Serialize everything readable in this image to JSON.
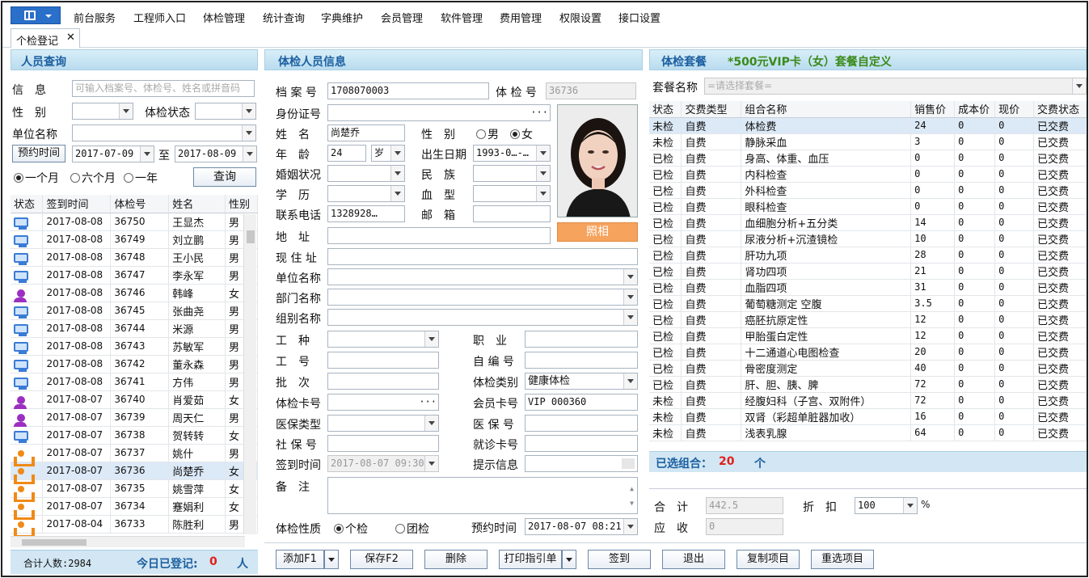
{
  "menu": {
    "items": [
      "前台服务",
      "工程师入口",
      "体检管理",
      "统计查询",
      "字典维护",
      "会员管理",
      "软件管理",
      "费用管理",
      "权限设置",
      "接口设置"
    ]
  },
  "tabs": {
    "active": "个检登记",
    "close": "✕"
  },
  "left": {
    "title": "人员查询",
    "info_label": "信　息",
    "info_placeholder": "可输入档案号、体检号、姓名或拼音码",
    "gender_label": "性　别",
    "status_label": "体检状态",
    "unit_label": "单位名称",
    "appt_label": "预约时间",
    "date_from": "2017-07-09",
    "to": "至",
    "date_to": "2017-08-09",
    "ranges": [
      "一个月",
      "六个月",
      "一年"
    ],
    "query_btn": "查询",
    "columns": [
      "状态",
      "签到时间",
      "体检号",
      "姓名",
      "性别"
    ],
    "rows": [
      {
        "icon": "pc",
        "date": "2017-08-08",
        "id": "36750",
        "name": "王显杰",
        "sex": "男"
      },
      {
        "icon": "pc",
        "date": "2017-08-08",
        "id": "36749",
        "name": "刘立鹏",
        "sex": "男"
      },
      {
        "icon": "pc",
        "date": "2017-08-08",
        "id": "36748",
        "name": "王小民",
        "sex": "男"
      },
      {
        "icon": "pc",
        "date": "2017-08-08",
        "id": "36747",
        "name": "李永军",
        "sex": "男"
      },
      {
        "icon": "f",
        "date": "2017-08-08",
        "id": "36746",
        "name": "韩峰",
        "sex": "女"
      },
      {
        "icon": "pc",
        "date": "2017-08-08",
        "id": "36745",
        "name": "张曲尧",
        "sex": "男"
      },
      {
        "icon": "pc",
        "date": "2017-08-08",
        "id": "36744",
        "name": "米源",
        "sex": "男"
      },
      {
        "icon": "pc",
        "date": "2017-08-08",
        "id": "36743",
        "name": "苏敏军",
        "sex": "男"
      },
      {
        "icon": "pc",
        "date": "2017-08-08",
        "id": "36742",
        "name": "董永森",
        "sex": "男"
      },
      {
        "icon": "pc",
        "date": "2017-08-08",
        "id": "36741",
        "name": "方伟",
        "sex": "男"
      },
      {
        "icon": "f",
        "date": "2017-08-07",
        "id": "36740",
        "name": "肖爱茹",
        "sex": "女"
      },
      {
        "icon": "f",
        "date": "2017-08-07",
        "id": "36739",
        "name": "周天仁",
        "sex": "男"
      },
      {
        "icon": "pc",
        "date": "2017-08-07",
        "id": "36738",
        "name": "贺转转",
        "sex": "女"
      },
      {
        "icon": "o",
        "date": "2017-08-07",
        "id": "36737",
        "name": "姚什",
        "sex": "男"
      },
      {
        "icon": "o",
        "date": "2017-08-07",
        "id": "36736",
        "name": "尚楚乔",
        "sex": "女",
        "selected": true
      },
      {
        "icon": "o",
        "date": "2017-08-07",
        "id": "36735",
        "name": "姚雪萍",
        "sex": "女"
      },
      {
        "icon": "o",
        "date": "2017-08-07",
        "id": "36734",
        "name": "蹇娟利",
        "sex": "女"
      },
      {
        "icon": "o",
        "date": "2017-08-04",
        "id": "36733",
        "name": "陈胜利",
        "sex": "男"
      }
    ],
    "total_label": "合计人数:2984",
    "today_label": "今日已登记:",
    "today_count": "0",
    "today_unit": "人"
  },
  "mid": {
    "title": "体检人员信息",
    "archive_label": "档 案 号",
    "archive": "1708070003",
    "exam_no_label": "体 检 号",
    "exam_no": "36736",
    "idcard_label": "身份证号",
    "name_label": "姓　名",
    "name": "尚楚乔",
    "sex_label": "性　别",
    "male": "男",
    "female": "女",
    "age_label": "年　龄",
    "age": "24",
    "age_unit": "岁",
    "birth_label": "出生日期",
    "birth": "1993-0…-…",
    "marital_label": "婚姻状况",
    "nation_label": "民　族",
    "edu_label": "学　历",
    "blood_label": "血　型",
    "phone_label": "联系电话",
    "phone": "1328928…",
    "email_label": "邮　箱",
    "addr_label": "地　址",
    "cur_addr_label": "现 住 址",
    "unit_label": "单位名称",
    "dept_label": "部门名称",
    "group_label": "组别名称",
    "work_label": "工　种",
    "job_label": "职　业",
    "empno_label": "工　号",
    "selfno_label": "自 编 号",
    "batch_label": "批　次",
    "category_label": "体检类别",
    "category": "健康体检",
    "card_label": "体检卡号",
    "member_label": "会员卡号",
    "member": "VIP 000360",
    "ins_type_label": "医保类型",
    "ins_no_label": "医 保 号",
    "social_label": "社 保 号",
    "visit_label": "就诊卡号",
    "checkin_label": "签到时间",
    "checkin": "2017-08-07 09:30",
    "hint_label": "提示信息",
    "remark_label": "备　注",
    "nature_label": "体检性质",
    "personal": "个检",
    "group": "团检",
    "appt_label": "预约时间",
    "appt": "2017-08-07 08:21",
    "photo_btn": "照相"
  },
  "right": {
    "title": "体检套餐",
    "package": "*500元VIP卡（女）套餐自定义",
    "pkg_label": "套餐名称",
    "pkg_placeholder": "=请选择套餐=",
    "columns": [
      "状态",
      "交费类型",
      "组合名称",
      "销售价",
      "成本价",
      "现价",
      "交费状态"
    ],
    "rows": [
      {
        "s": "未检",
        "t": "自费",
        "n": "体检费",
        "p": "24",
        "c": "0",
        "x": "0",
        "ps": "已交费",
        "selected": true
      },
      {
        "s": "未检",
        "t": "自费",
        "n": "静脉采血",
        "p": "3",
        "c": "0",
        "x": "0",
        "ps": "已交费"
      },
      {
        "s": "已检",
        "t": "自费",
        "n": "身高、体重、血压",
        "p": "0",
        "c": "0",
        "x": "0",
        "ps": "已交费"
      },
      {
        "s": "已检",
        "t": "自费",
        "n": "内科检查",
        "p": "0",
        "c": "0",
        "x": "0",
        "ps": "已交费"
      },
      {
        "s": "已检",
        "t": "自费",
        "n": "外科检查",
        "p": "0",
        "c": "0",
        "x": "0",
        "ps": "已交费"
      },
      {
        "s": "已检",
        "t": "自费",
        "n": "眼科检查",
        "p": "0",
        "c": "0",
        "x": "0",
        "ps": "已交费"
      },
      {
        "s": "已检",
        "t": "自费",
        "n": "血细胞分析+五分类",
        "p": "14",
        "c": "0",
        "x": "0",
        "ps": "已交费"
      },
      {
        "s": "已检",
        "t": "自费",
        "n": "尿液分析+沉渣镜检",
        "p": "10",
        "c": "0",
        "x": "0",
        "ps": "已交费"
      },
      {
        "s": "已检",
        "t": "自费",
        "n": "肝功九项",
        "p": "28",
        "c": "0",
        "x": "0",
        "ps": "已交费"
      },
      {
        "s": "已检",
        "t": "自费",
        "n": "肾功四项",
        "p": "21",
        "c": "0",
        "x": "0",
        "ps": "已交费"
      },
      {
        "s": "已检",
        "t": "自费",
        "n": "血脂四项",
        "p": "31",
        "c": "0",
        "x": "0",
        "ps": "已交费"
      },
      {
        "s": "已检",
        "t": "自费",
        "n": "葡萄糖测定 空腹",
        "p": "3.5",
        "c": "0",
        "x": "0",
        "ps": "已交费"
      },
      {
        "s": "已检",
        "t": "自费",
        "n": "癌胚抗原定性",
        "p": "12",
        "c": "0",
        "x": "0",
        "ps": "已交费"
      },
      {
        "s": "已检",
        "t": "自费",
        "n": "甲胎蛋白定性",
        "p": "12",
        "c": "0",
        "x": "0",
        "ps": "已交费"
      },
      {
        "s": "已检",
        "t": "自费",
        "n": "十二通道心电图检查",
        "p": "20",
        "c": "0",
        "x": "0",
        "ps": "已交费"
      },
      {
        "s": "已检",
        "t": "自费",
        "n": "骨密度测定",
        "p": "40",
        "c": "0",
        "x": "0",
        "ps": "已交费"
      },
      {
        "s": "已检",
        "t": "自费",
        "n": "肝、胆、胰、脾",
        "p": "72",
        "c": "0",
        "x": "0",
        "ps": "已交费"
      },
      {
        "s": "未检",
        "t": "自费",
        "n": "经腹妇科（子宫、双附件）",
        "p": "72",
        "c": "0",
        "x": "0",
        "ps": "已交费"
      },
      {
        "s": "未检",
        "t": "自费",
        "n": "双肾（彩超单脏器加收）",
        "p": "16",
        "c": "0",
        "x": "0",
        "ps": "已交费"
      },
      {
        "s": "未检",
        "t": "自费",
        "n": "浅表乳腺",
        "p": "64",
        "c": "0",
        "x": "0",
        "ps": "已交费"
      }
    ],
    "selected_label": "已选组合：",
    "selected_count": "20",
    "selected_unit": "个",
    "total_label": "合　计",
    "total": "442.5",
    "discount_label": "折　扣",
    "discount": "100",
    "percent": "%",
    "due_label": "应　收",
    "due": "0"
  },
  "toolbar": {
    "add": "添加F1",
    "save": "保存F2",
    "delete": "删除",
    "print": "打印指引单",
    "checkin": "签到",
    "exit": "退出",
    "copy": "复制项目",
    "reselect": "重选项目"
  },
  "colors": {
    "header_text": "#1b5fa0",
    "package_text": "#3a8a1a",
    "count_red": "#e0201a",
    "panel_bg": "#d8eef8",
    "selected_row": "#dce9f7"
  }
}
